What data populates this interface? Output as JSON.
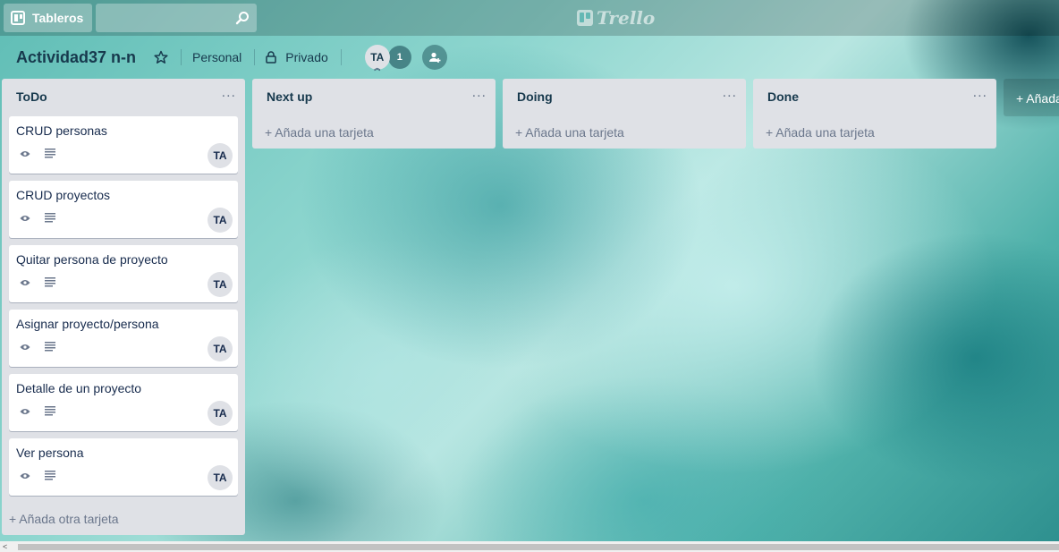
{
  "topbar": {
    "boards_label": "Tableros",
    "search_value": "",
    "logo_text": "Trello"
  },
  "board": {
    "title": "Actividad37 n-n",
    "team": "Personal",
    "visibility": "Privado",
    "member_initials": "TA",
    "member_count": "1"
  },
  "lists": [
    {
      "title": "ToDo",
      "menu": "...",
      "add_card_label": "+ Añada otra tarjeta",
      "cards": [
        {
          "title": "CRUD personas",
          "member": "TA"
        },
        {
          "title": "CRUD proyectos",
          "member": "TA"
        },
        {
          "title": "Quitar persona de proyecto",
          "member": "TA"
        },
        {
          "title": "Asignar proyecto/persona",
          "member": "TA"
        },
        {
          "title": "Detalle de un proyecto",
          "member": "TA"
        },
        {
          "title": "Ver persona",
          "member": "TA"
        }
      ]
    },
    {
      "title": "Next up",
      "menu": "...",
      "add_card_label": "+ Añada una tarjeta",
      "cards": []
    },
    {
      "title": "Doing",
      "menu": "...",
      "add_card_label": "+ Añada una tarjeta",
      "cards": []
    },
    {
      "title": "Done",
      "menu": "...",
      "add_card_label": "+ Añada una tarjeta",
      "cards": []
    }
  ],
  "add_list_label": "+ Añada",
  "icons": {
    "boards": "boards-icon",
    "search": "search-icon",
    "star": "star-icon",
    "lock": "lock-icon",
    "add_member": "add-member-icon",
    "watch": "eye-icon",
    "description": "description-icon"
  }
}
